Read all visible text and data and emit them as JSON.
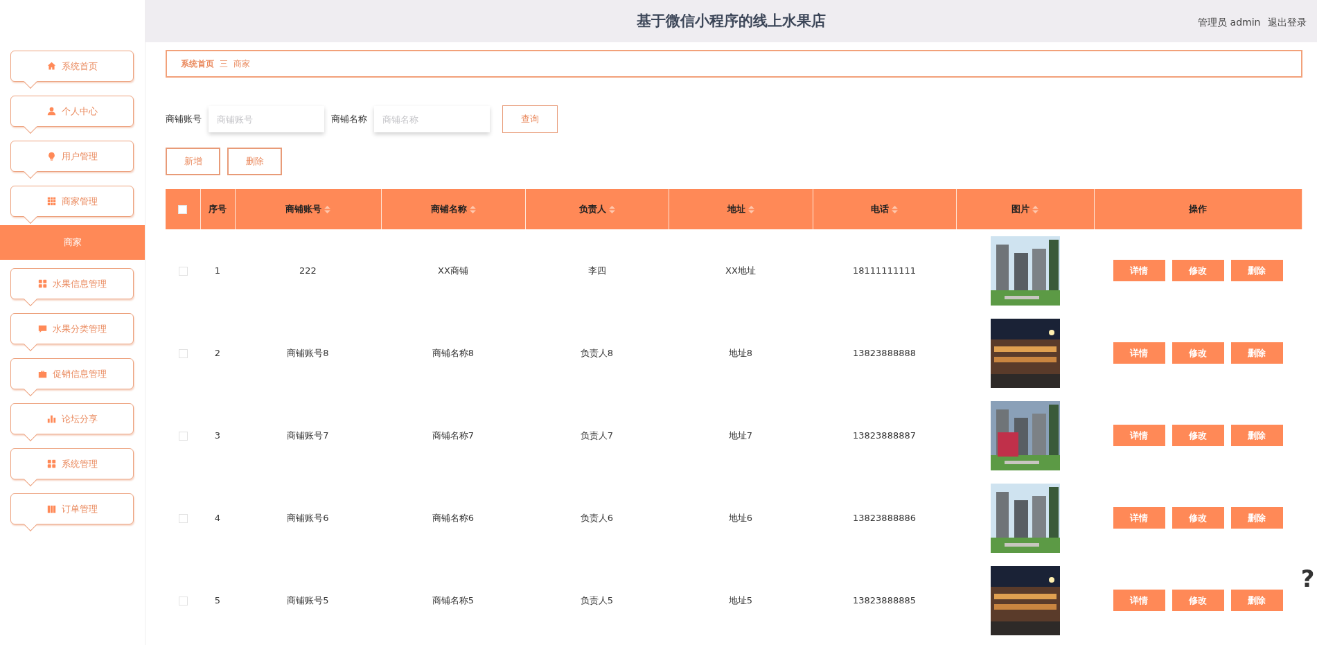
{
  "header": {
    "title": "基于微信小程序的线上水果店",
    "user_label": "管理员 admin",
    "logout": "退出登录"
  },
  "sidebar": {
    "items": [
      {
        "label": "系统首页",
        "selected": false
      },
      {
        "label": "个人中心",
        "selected": false
      },
      {
        "label": "用户管理",
        "selected": false
      },
      {
        "label": "商家管理",
        "selected": false,
        "children": [
          {
            "label": "商家",
            "selected": true
          }
        ]
      },
      {
        "label": "水果信息管理",
        "selected": false
      },
      {
        "label": "水果分类管理",
        "selected": false
      },
      {
        "label": "促销信息管理",
        "selected": false
      },
      {
        "label": "论坛分享",
        "selected": false
      },
      {
        "label": "系统管理",
        "selected": false
      },
      {
        "label": "订单管理",
        "selected": false
      }
    ]
  },
  "breadcrumb": {
    "home": "系统首页",
    "separator": "三",
    "current": "商家"
  },
  "search": {
    "fields": [
      {
        "label": "商铺账号",
        "placeholder": "商铺账号"
      },
      {
        "label": "商铺名称",
        "placeholder": "商铺名称"
      }
    ],
    "button": "查询"
  },
  "actions": [
    "新增",
    "删除"
  ],
  "table": {
    "header_checked": false,
    "columns": [
      {
        "label": "序号",
        "sortable": false
      },
      {
        "label": "商铺账号",
        "sortable": true
      },
      {
        "label": "商铺名称",
        "sortable": true
      },
      {
        "label": "负责人",
        "sortable": true
      },
      {
        "label": "地址",
        "sortable": true
      },
      {
        "label": "电话",
        "sortable": true
      },
      {
        "label": "图片",
        "sortable": true
      },
      {
        "label": "操作",
        "sortable": false
      }
    ],
    "rows": [
      {
        "checked": false,
        "cells": [
          "1",
          "222",
          "XX商铺",
          "李四",
          "XX地址",
          "18111111111"
        ],
        "buttons": [
          "详情",
          "修改",
          "删除"
        ]
      },
      {
        "checked": false,
        "cells": [
          "2",
          "商铺账号8",
          "商铺名称8",
          "负责人8",
          "地址8",
          "13823888888"
        ],
        "buttons": [
          "详情",
          "修改",
          "删除"
        ]
      },
      {
        "checked": false,
        "cells": [
          "3",
          "商铺账号7",
          "商铺名称7",
          "负责人7",
          "地址7",
          "13823888887"
        ],
        "buttons": [
          "详情",
          "修改",
          "删除"
        ]
      },
      {
        "checked": false,
        "cells": [
          "4",
          "商铺账号6",
          "商铺名称6",
          "负责人6",
          "地址6",
          "13823888886"
        ],
        "buttons": [
          "详情",
          "修改",
          "删除"
        ]
      },
      {
        "checked": false,
        "cells": [
          "5",
          "商铺账号5",
          "商铺名称5",
          "负责人5",
          "地址5",
          "13823888885"
        ],
        "buttons": [
          "详情",
          "修改",
          "删除"
        ]
      }
    ]
  },
  "edge_mark": "?"
}
